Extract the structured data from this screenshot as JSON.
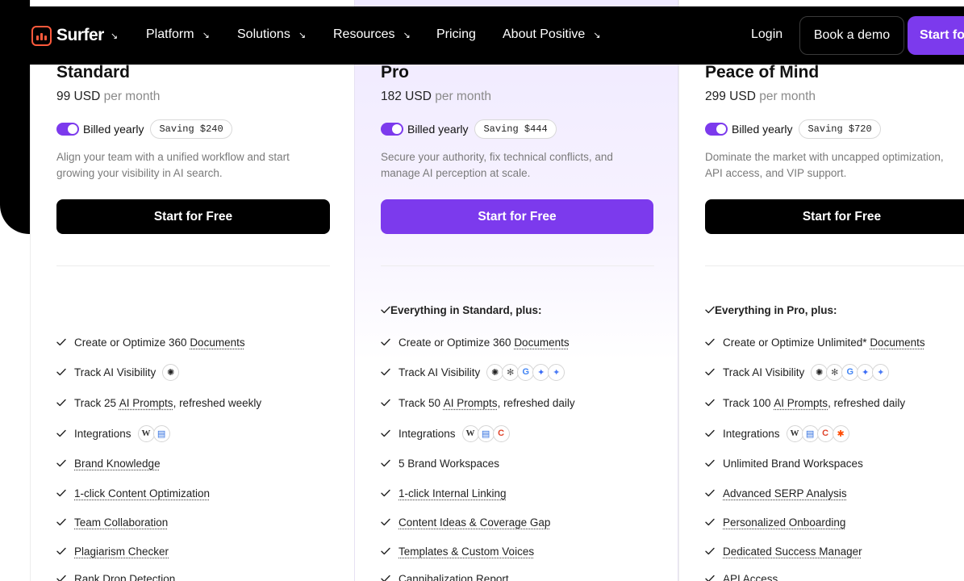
{
  "nav": {
    "logo": "Surfer",
    "items": [
      {
        "label": "Platform",
        "dropdown": true
      },
      {
        "label": "Solutions",
        "dropdown": true
      },
      {
        "label": "Resources",
        "dropdown": true
      },
      {
        "label": "Pricing",
        "dropdown": false
      },
      {
        "label": "About Positive",
        "dropdown": true
      }
    ],
    "login": "Login",
    "demo": "Book a demo",
    "start": "Start for Free",
    "arrow_glyph": "↘"
  },
  "colors": {
    "accent": "#7c3aed",
    "logo": "#ff5a3c"
  },
  "plans": [
    {
      "name": "Standard",
      "price": "99 USD",
      "per": "per month",
      "billing": "Billed yearly",
      "saving": "Saving $240",
      "desc_line1": "Align your team with a unified workflow and start",
      "desc_line2": "growing your visibility in AI search.",
      "cta": "Start for Free",
      "features": [
        {
          "pre": "Create or Optimize 360 ",
          "link": "Documents",
          "post": ""
        },
        {
          "pre": "Track AI Visibility",
          "link": "",
          "post": "",
          "icons": [
            "chatgpt-icon"
          ]
        },
        {
          "pre": "Track 25 ",
          "link": "AI Prompts",
          "post": ", refreshed weekly"
        },
        {
          "pre": "Integrations",
          "link": "",
          "post": "",
          "icons": [
            "wordpress-icon",
            "google-docs-icon"
          ]
        },
        {
          "pre": "",
          "link": "Brand Knowledge",
          "post": ""
        },
        {
          "pre": "",
          "link": "1-click Content Optimization",
          "post": ""
        },
        {
          "pre": "",
          "link": "Team Collaboration",
          "post": ""
        },
        {
          "pre": "",
          "link": "Plagiarism Checker",
          "post": ""
        },
        {
          "pre": "",
          "link": "Rank Drop Detection",
          "post": ""
        }
      ]
    },
    {
      "name": "Pro",
      "price": "182 USD",
      "per": "per month",
      "billing": "Billed yearly",
      "saving": "Saving $444",
      "desc_line1": "Secure your authority, fix technical conflicts, and",
      "desc_line2": "manage AI perception at scale.",
      "cta": "Start for Free",
      "heading": "Everything in Standard, plus:",
      "features": [
        {
          "pre": "Create or Optimize 360 ",
          "link": "Documents",
          "post": ""
        },
        {
          "pre": "Track AI Visibility",
          "link": "",
          "post": "",
          "icons": [
            "chatgpt-icon",
            "claude-icon",
            "google-icon",
            "gemini-icon",
            "gemini-alt-icon"
          ]
        },
        {
          "pre": "Track 50 ",
          "link": "AI Prompts",
          "post": ", refreshed daily"
        },
        {
          "pre": "Integrations",
          "link": "",
          "post": "",
          "icons": [
            "wordpress-icon",
            "google-docs-icon",
            "contentful-icon"
          ]
        },
        {
          "pre": "5 Brand Workspaces",
          "link": "",
          "post": ""
        },
        {
          "pre": "",
          "link": "1-click Internal Linking",
          "post": ""
        },
        {
          "pre": "",
          "link": "Content Ideas & Coverage Gap",
          "post": ""
        },
        {
          "pre": "",
          "link": "Templates & Custom Voices",
          "post": ""
        },
        {
          "pre": "",
          "link": "Cannibalization Report",
          "post": ""
        }
      ]
    },
    {
      "name": "Peace of Mind",
      "price": "299 USD",
      "per": "per month",
      "billing": "Billed yearly",
      "saving": "Saving $720",
      "desc_line1": "Dominate the market with uncapped optimization,",
      "desc_line2": "API access, and VIP support.",
      "cta": "Start for Free",
      "heading": "Everything in Pro, plus:",
      "features": [
        {
          "pre": "Create or Optimize Unlimited* ",
          "link": "Documents",
          "post": ""
        },
        {
          "pre": "Track AI Visibility",
          "link": "",
          "post": "",
          "icons": [
            "chatgpt-icon",
            "claude-icon",
            "google-icon",
            "gemini-icon",
            "gemini-alt-icon"
          ]
        },
        {
          "pre": "Track 100 ",
          "link": "AI Prompts",
          "post": ", refreshed daily"
        },
        {
          "pre": "Integrations",
          "link": "",
          "post": "",
          "icons": [
            "wordpress-icon",
            "google-docs-icon",
            "contentful-icon",
            "zapier-icon"
          ]
        },
        {
          "pre": "Unlimited Brand Workspaces",
          "link": "",
          "post": ""
        },
        {
          "pre": "",
          "link": "Advanced SERP Analysis",
          "post": ""
        },
        {
          "pre": "",
          "link": "Personalized Onboarding",
          "post": ""
        },
        {
          "pre": "",
          "link": "Dedicated Success Manager",
          "post": ""
        },
        {
          "pre": "",
          "link": "API Access",
          "post": ""
        }
      ]
    }
  ]
}
